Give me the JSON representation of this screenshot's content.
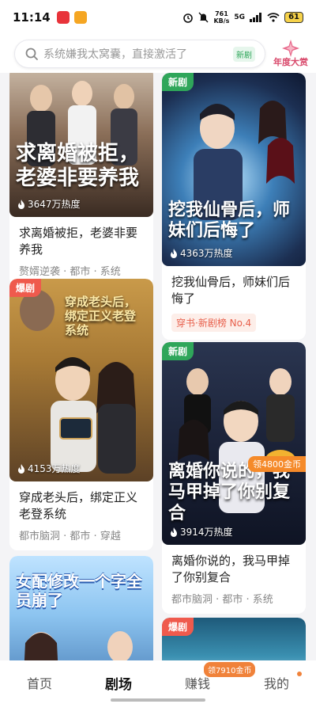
{
  "status_bar": {
    "time": "11:14",
    "net_speed_value": "761",
    "net_speed_unit": "KB/s",
    "network": "5G",
    "battery": "61"
  },
  "search": {
    "placeholder": "系统嫌我太窝囊，直接激活了",
    "tag": "新剧"
  },
  "award_label": "年度大赏",
  "dramas": [
    {
      "poster_title": "求离婚被拒，老婆非要养我",
      "heat": "3647万热度",
      "title": "求离婚被拒，老婆非要养我",
      "tags": "赘婿逆袭 · 都市 · 系统",
      "badge": ""
    },
    {
      "poster_title": "挖我仙骨后，师妹们后悔了",
      "heat": "4363万热度",
      "title": "挖我仙骨后，师妹们后悔了",
      "rank": "穿书·新剧榜 No.4",
      "badge": "新剧"
    },
    {
      "poster_title": "穿成老头后，绑定正义老登系统",
      "heat": "4153万热度",
      "title": "穿成老头后，绑定正义老登系统",
      "tags": "都市脑洞 · 都市 · 穿越",
      "badge": "爆剧"
    },
    {
      "poster_title": "离婚你说的，我马甲掉了你别复合",
      "heat": "3914万热度",
      "title": "离婚你说的，我马甲掉了你别复合",
      "tags": "都市脑洞 · 都市 · 系统",
      "badge": "新剧",
      "coin_tag": "领4800金币"
    },
    {
      "poster_title": "女配修改一个字全员崩了",
      "badge": ""
    },
    {
      "badge": "爆剧"
    }
  ],
  "nav": {
    "home": "首页",
    "theater": "剧场",
    "earn": "赚钱",
    "earn_badge": "领7910金币",
    "mine": "我的"
  },
  "colors": {
    "accent_green": "#2fa65a",
    "hot_red": "#ef5a4d",
    "coin_orange": "#f0823a"
  }
}
